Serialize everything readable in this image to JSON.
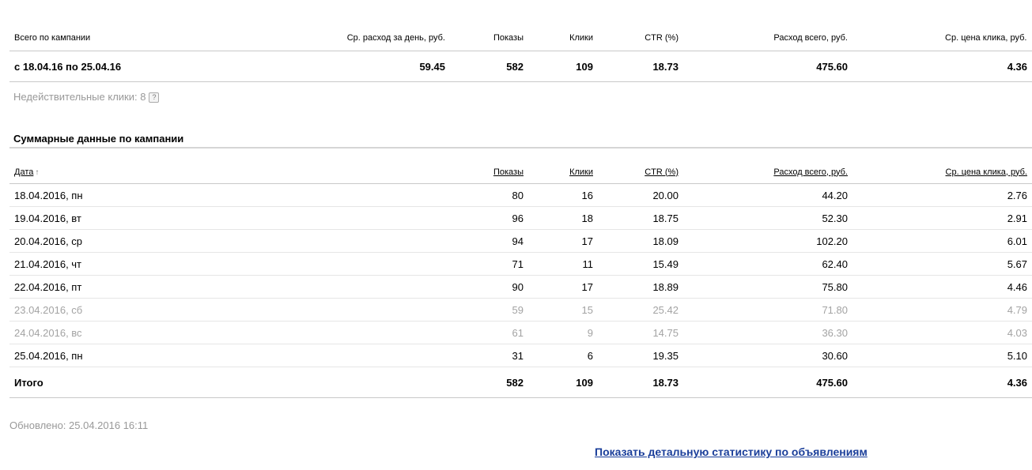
{
  "summary": {
    "headers": [
      "Всего по кампании",
      "Ср. расход за день, руб.",
      "Показы",
      "Клики",
      "CTR (%)",
      "Расход всего, руб.",
      "Ср. цена клика, руб."
    ],
    "row": [
      "с 18.04.16 по 25.04.16",
      "59.45",
      "582",
      "109",
      "18.73",
      "475.60",
      "4.36"
    ]
  },
  "invalid_clicks": {
    "label": "Недействительные клики: 8",
    "help": "?"
  },
  "section_title": "Суммарные данные по кампании",
  "daily": {
    "headers": [
      "Дата",
      "Показы",
      "Клики",
      "CTR (%)",
      "Расход всего, руб.",
      "Ср. цена клика, руб."
    ],
    "sort_arrow": "↑",
    "rows": [
      [
        "18.04.2016, пн",
        "80",
        "16",
        "20.00",
        "44.20",
        "2.76"
      ],
      [
        "19.04.2016, вт",
        "96",
        "18",
        "18.75",
        "52.30",
        "2.91"
      ],
      [
        "20.04.2016, ср",
        "94",
        "17",
        "18.09",
        "102.20",
        "6.01"
      ],
      [
        "21.04.2016, чт",
        "71",
        "11",
        "15.49",
        "62.40",
        "5.67"
      ],
      [
        "22.04.2016, пт",
        "90",
        "17",
        "18.89",
        "75.80",
        "4.46"
      ],
      [
        "23.04.2016, сб",
        "59",
        "15",
        "25.42",
        "71.80",
        "4.79"
      ],
      [
        "24.04.2016, вс",
        "61",
        "9",
        "14.75",
        "36.30",
        "4.03"
      ],
      [
        "25.04.2016, пн",
        "31",
        "6",
        "19.35",
        "30.60",
        "5.10"
      ]
    ],
    "total": [
      "Итого",
      "582",
      "109",
      "18.73",
      "475.60",
      "4.36"
    ]
  },
  "updated": "Обновлено: 25.04.2016 16:11",
  "details_link": "Показать детальную статистику по объявлениям"
}
